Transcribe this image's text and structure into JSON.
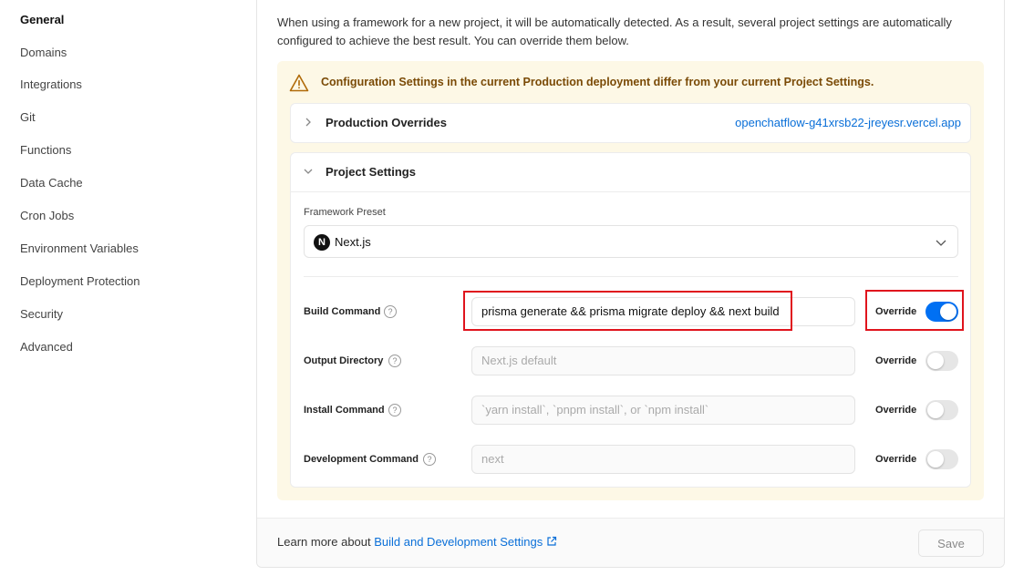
{
  "sidebar": {
    "items": [
      {
        "label": "General",
        "active": true
      },
      {
        "label": "Domains"
      },
      {
        "label": "Integrations"
      },
      {
        "label": "Git"
      },
      {
        "label": "Functions"
      },
      {
        "label": "Data Cache"
      },
      {
        "label": "Cron Jobs"
      },
      {
        "label": "Environment Variables"
      },
      {
        "label": "Deployment Protection"
      },
      {
        "label": "Security"
      },
      {
        "label": "Advanced"
      }
    ]
  },
  "intro": "When using a framework for a new project, it will be automatically detected. As a result, several project settings are automatically configured to achieve the best result. You can override them below.",
  "warning": {
    "text": "Configuration Settings in the current Production deployment differ from your current Project Settings.",
    "color": "#7a4a06",
    "background": "#fdf8e6"
  },
  "production_overrides": {
    "title": "Production Overrides",
    "link": "openchatflow-g41xrsb22-jreyesr.vercel.app",
    "icon": "chevron-right-icon"
  },
  "project_settings": {
    "title": "Project Settings",
    "icon": "chevron-down-icon",
    "framework_label": "Framework Preset",
    "framework_value": "Next.js",
    "framework_logo": "N",
    "rows": [
      {
        "label": "Build Command",
        "value": "prisma generate && prisma migrate deploy && next build",
        "placeholder": "",
        "override_label": "Override",
        "override_on": true
      },
      {
        "label": "Output Directory",
        "value": "",
        "placeholder": "Next.js default",
        "override_label": "Override",
        "override_on": false
      },
      {
        "label": "Install Command",
        "value": "",
        "placeholder": "`yarn install`, `pnpm install`, or `npm install`",
        "override_label": "Override",
        "override_on": false
      },
      {
        "label": "Development Command",
        "value": "",
        "placeholder": "next",
        "override_label": "Override",
        "override_on": false
      }
    ]
  },
  "footer": {
    "prefix": "Learn more about ",
    "link": "Build and Development Settings",
    "save_label": "Save"
  },
  "colors": {
    "accent": "#0070f3",
    "link": "#0a6fd8",
    "highlight": "#e0141d"
  }
}
